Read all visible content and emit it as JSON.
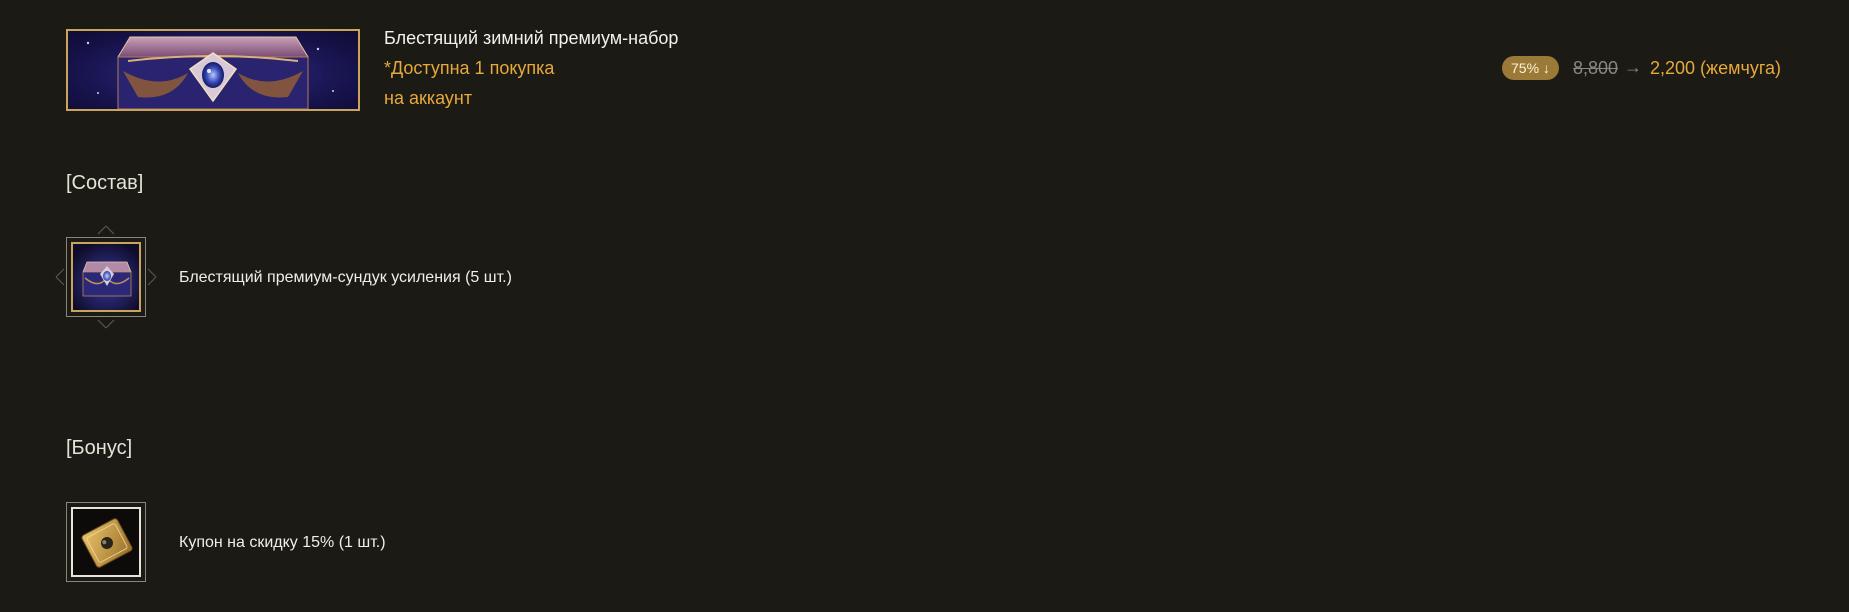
{
  "package": {
    "title": "Блестящий зимний премиум-набор",
    "limit_line1": "*Доступна 1 покупка",
    "limit_line2": "на аккаунт",
    "banner_icon": "premium-chest-banner"
  },
  "price": {
    "discount_badge": "75% ↓",
    "old_price": "8,800",
    "arrow": "→",
    "new_price": "2,200 (жемчуга)"
  },
  "composition": {
    "title": "[Состав]",
    "items": [
      {
        "label": "Блестящий премиум-сундук усиления (5 шт.)",
        "icon": "enhancement-chest-icon"
      }
    ]
  },
  "bonus": {
    "title": "[Бонус]",
    "items": [
      {
        "label": "Купон на скидку 15% (1 шт.)",
        "icon": "discount-coupon-icon"
      }
    ]
  },
  "colors": {
    "background": "#1b1a14",
    "accent_gold": "#e6a93a",
    "badge": "#9a7a36",
    "frame_gold": "#c9a45a"
  }
}
